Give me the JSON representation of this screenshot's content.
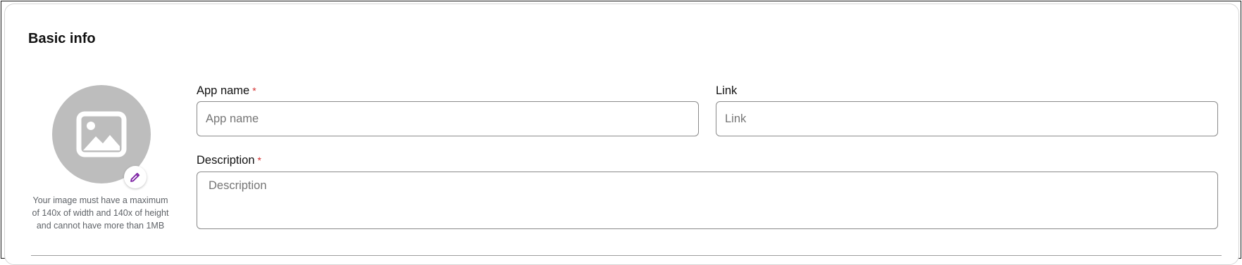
{
  "section": {
    "title": "Basic info"
  },
  "avatar": {
    "icon": "image-placeholder-icon",
    "edit_icon": "pencil-icon",
    "hint": "Your image must have a maximum of 140x of width and 140x of height and cannot have more than 1MB"
  },
  "fields": {
    "app_name": {
      "label": "App name",
      "required_mark": "*",
      "placeholder": "App name",
      "value": ""
    },
    "link": {
      "label": "Link",
      "placeholder": "Link",
      "value": ""
    },
    "description": {
      "label": "Description",
      "required_mark": "*",
      "placeholder": "Description",
      "value": ""
    }
  },
  "colors": {
    "required": "#d32f2f",
    "edit_icon": "#7b1fa2",
    "avatar_bg": "#bdbdbd"
  }
}
